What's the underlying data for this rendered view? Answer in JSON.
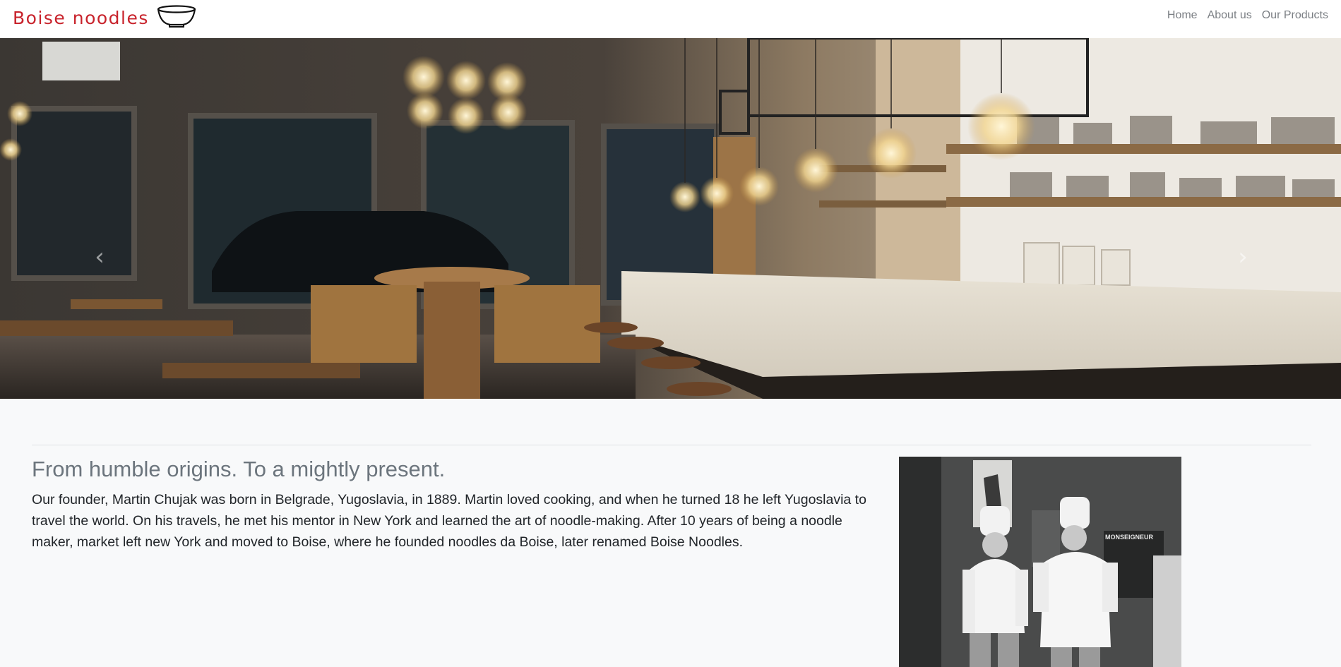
{
  "brand": {
    "name": "Boise noodles",
    "icon": "bowl-icon",
    "color": "#c8232c"
  },
  "nav": {
    "items": [
      "Home",
      "About us",
      "Our Products"
    ]
  },
  "carousel": {
    "prev_icon": "chevron-left-icon",
    "next_icon": "chevron-right-icon",
    "prev_glyph": "‹",
    "next_glyph": "›",
    "slide_count": 2,
    "active_index": 1,
    "image": "restaurant-interior-photo"
  },
  "about": {
    "heading": "From humble origins. To a mightly present.",
    "body": "Our founder, Martin Chujak was born in Belgrade, Yugoslavia, in 1889. Martin loved cooking, and when he turned 18 he left Yugoslavia to travel the world. On his travels, he met his mentor in New York and learned the art of noodle-making. After 10 years of being a noodle maker, market left new York and moved to Boise, where he founded noodles da Boise, later renamed Boise Noodles.",
    "photo": "founders-chefs-photo",
    "photo_sign": "MONSEIGNEUR"
  }
}
